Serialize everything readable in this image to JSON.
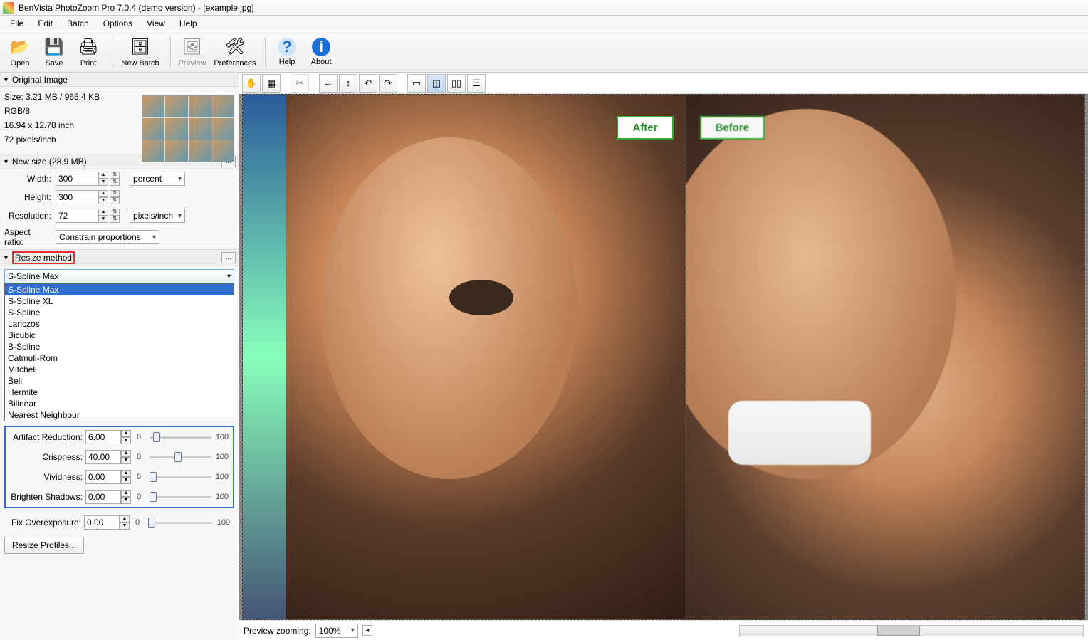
{
  "titlebar": {
    "text": "BenVista PhotoZoom Pro 7.0.4 (demo version) - [example.jpg]"
  },
  "menu": {
    "file": "File",
    "edit": "Edit",
    "batch": "Batch",
    "options": "Options",
    "view": "View",
    "help": "Help"
  },
  "toolbar": {
    "open": "Open",
    "save": "Save",
    "print": "Print",
    "newbatch": "New Batch",
    "preview": "Preview",
    "preferences": "Preferences",
    "help": "Help",
    "about": "About"
  },
  "orig": {
    "header": "Original Image",
    "size": "Size: 3.21 MB / 965.4 KB",
    "mode": "RGB/8",
    "dim": "16.94 x 12.78 inch",
    "res": "72 pixels/inch"
  },
  "newsize": {
    "header": "New size (28.9 MB)",
    "width_lbl": "Width:",
    "width": "300",
    "height_lbl": "Height:",
    "height": "300",
    "unit": "percent",
    "res_lbl": "Resolution:",
    "res": "72",
    "res_unit": "pixels/inch",
    "aspect_lbl": "Aspect ratio:",
    "aspect": "Constrain proportions"
  },
  "resize": {
    "header": "Resize method",
    "selected": "S-Spline Max",
    "options": [
      "S-Spline Max",
      "S-Spline XL",
      "S-Spline",
      "Lanczos",
      "Bicubic",
      "B-Spline",
      "Catmull-Rom",
      "Mitchell",
      "Bell",
      "Hermite",
      "Bilinear",
      "Nearest Neighbour"
    ]
  },
  "params": {
    "artifact_lbl": "Artifact Reduction:",
    "artifact": "6.00",
    "crisp_lbl": "Crispness:",
    "crisp": "40.00",
    "vivid_lbl": "Vividness:",
    "vivid": "0.00",
    "bright_lbl": "Brighten Shadows:",
    "bright": "0.00",
    "fix_lbl": "Fix Overexposure:",
    "fix": "0.00",
    "min": "0",
    "max": "100"
  },
  "profiles_btn": "Resize Profiles...",
  "preview": {
    "after": "After",
    "before": "Before"
  },
  "bottom": {
    "zoom_lbl": "Preview zooming:",
    "zoom": "100%"
  }
}
